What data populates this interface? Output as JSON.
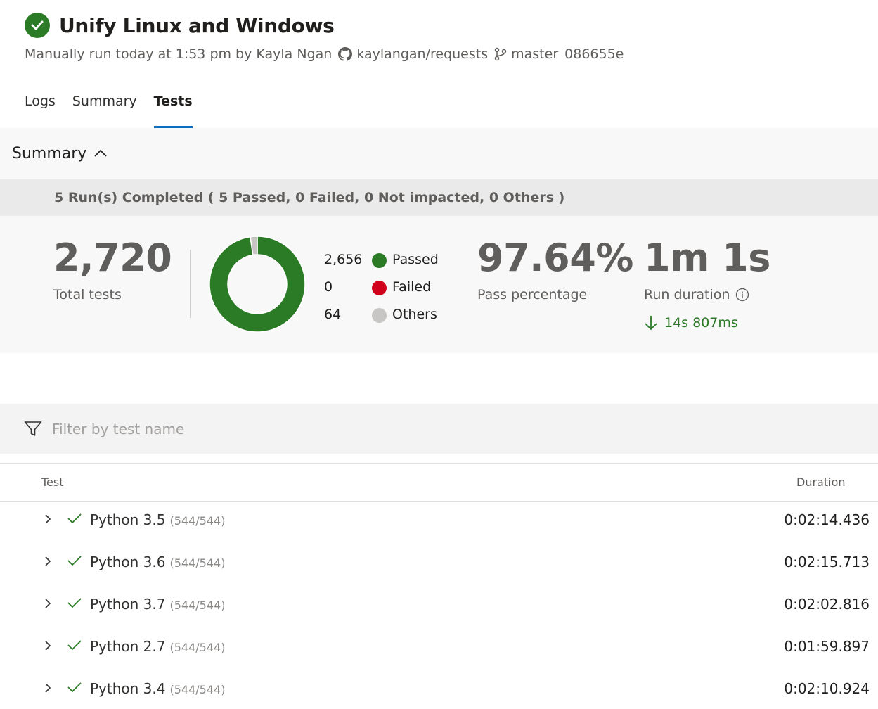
{
  "header": {
    "title": "Unify Linux and Windows",
    "run_info": "Manually run today at 1:53 pm by Kayla Ngan",
    "repo": "kaylangan/requests",
    "branch": "master",
    "commit": "086655e"
  },
  "tabs": [
    {
      "label": "Logs",
      "active": false
    },
    {
      "label": "Summary",
      "active": false
    },
    {
      "label": "Tests",
      "active": true
    }
  ],
  "summary": {
    "title": "Summary",
    "runs_completed": "5 Run(s) Completed ( 5 Passed, 0 Failed, 0 Not impacted, 0 Others )",
    "total_tests": "2,720",
    "total_tests_label": "Total tests",
    "legend": [
      {
        "count": "2,656",
        "label": "Passed",
        "value": 2656,
        "color": "#2b7a25"
      },
      {
        "count": "0",
        "label": "Failed",
        "value": 0,
        "color": "#d0021b"
      },
      {
        "count": "64",
        "label": "Others",
        "value": 64,
        "color": "#c8c6c4"
      }
    ],
    "pass_percentage": "97.64%",
    "pass_percentage_label": "Pass percentage",
    "run_duration": "1m 1s",
    "run_duration_label": "Run duration",
    "duration_delta": "14s 807ms"
  },
  "filter": {
    "placeholder": "Filter by test name"
  },
  "table": {
    "col_test": "Test",
    "col_duration": "Duration",
    "rows": [
      {
        "name": "Python 3.5",
        "count": "(544/544)",
        "duration": "0:02:14.436"
      },
      {
        "name": "Python 3.6",
        "count": "(544/544)",
        "duration": "0:02:15.713"
      },
      {
        "name": "Python 3.7",
        "count": "(544/544)",
        "duration": "0:02:02.816"
      },
      {
        "name": "Python 2.7",
        "count": "(544/544)",
        "duration": "0:01:59.897"
      },
      {
        "name": "Python 3.4",
        "count": "(544/544)",
        "duration": "0:02:10.924"
      }
    ]
  },
  "colors": {
    "success": "#2b7a25",
    "accent": "#0f6cbd"
  }
}
